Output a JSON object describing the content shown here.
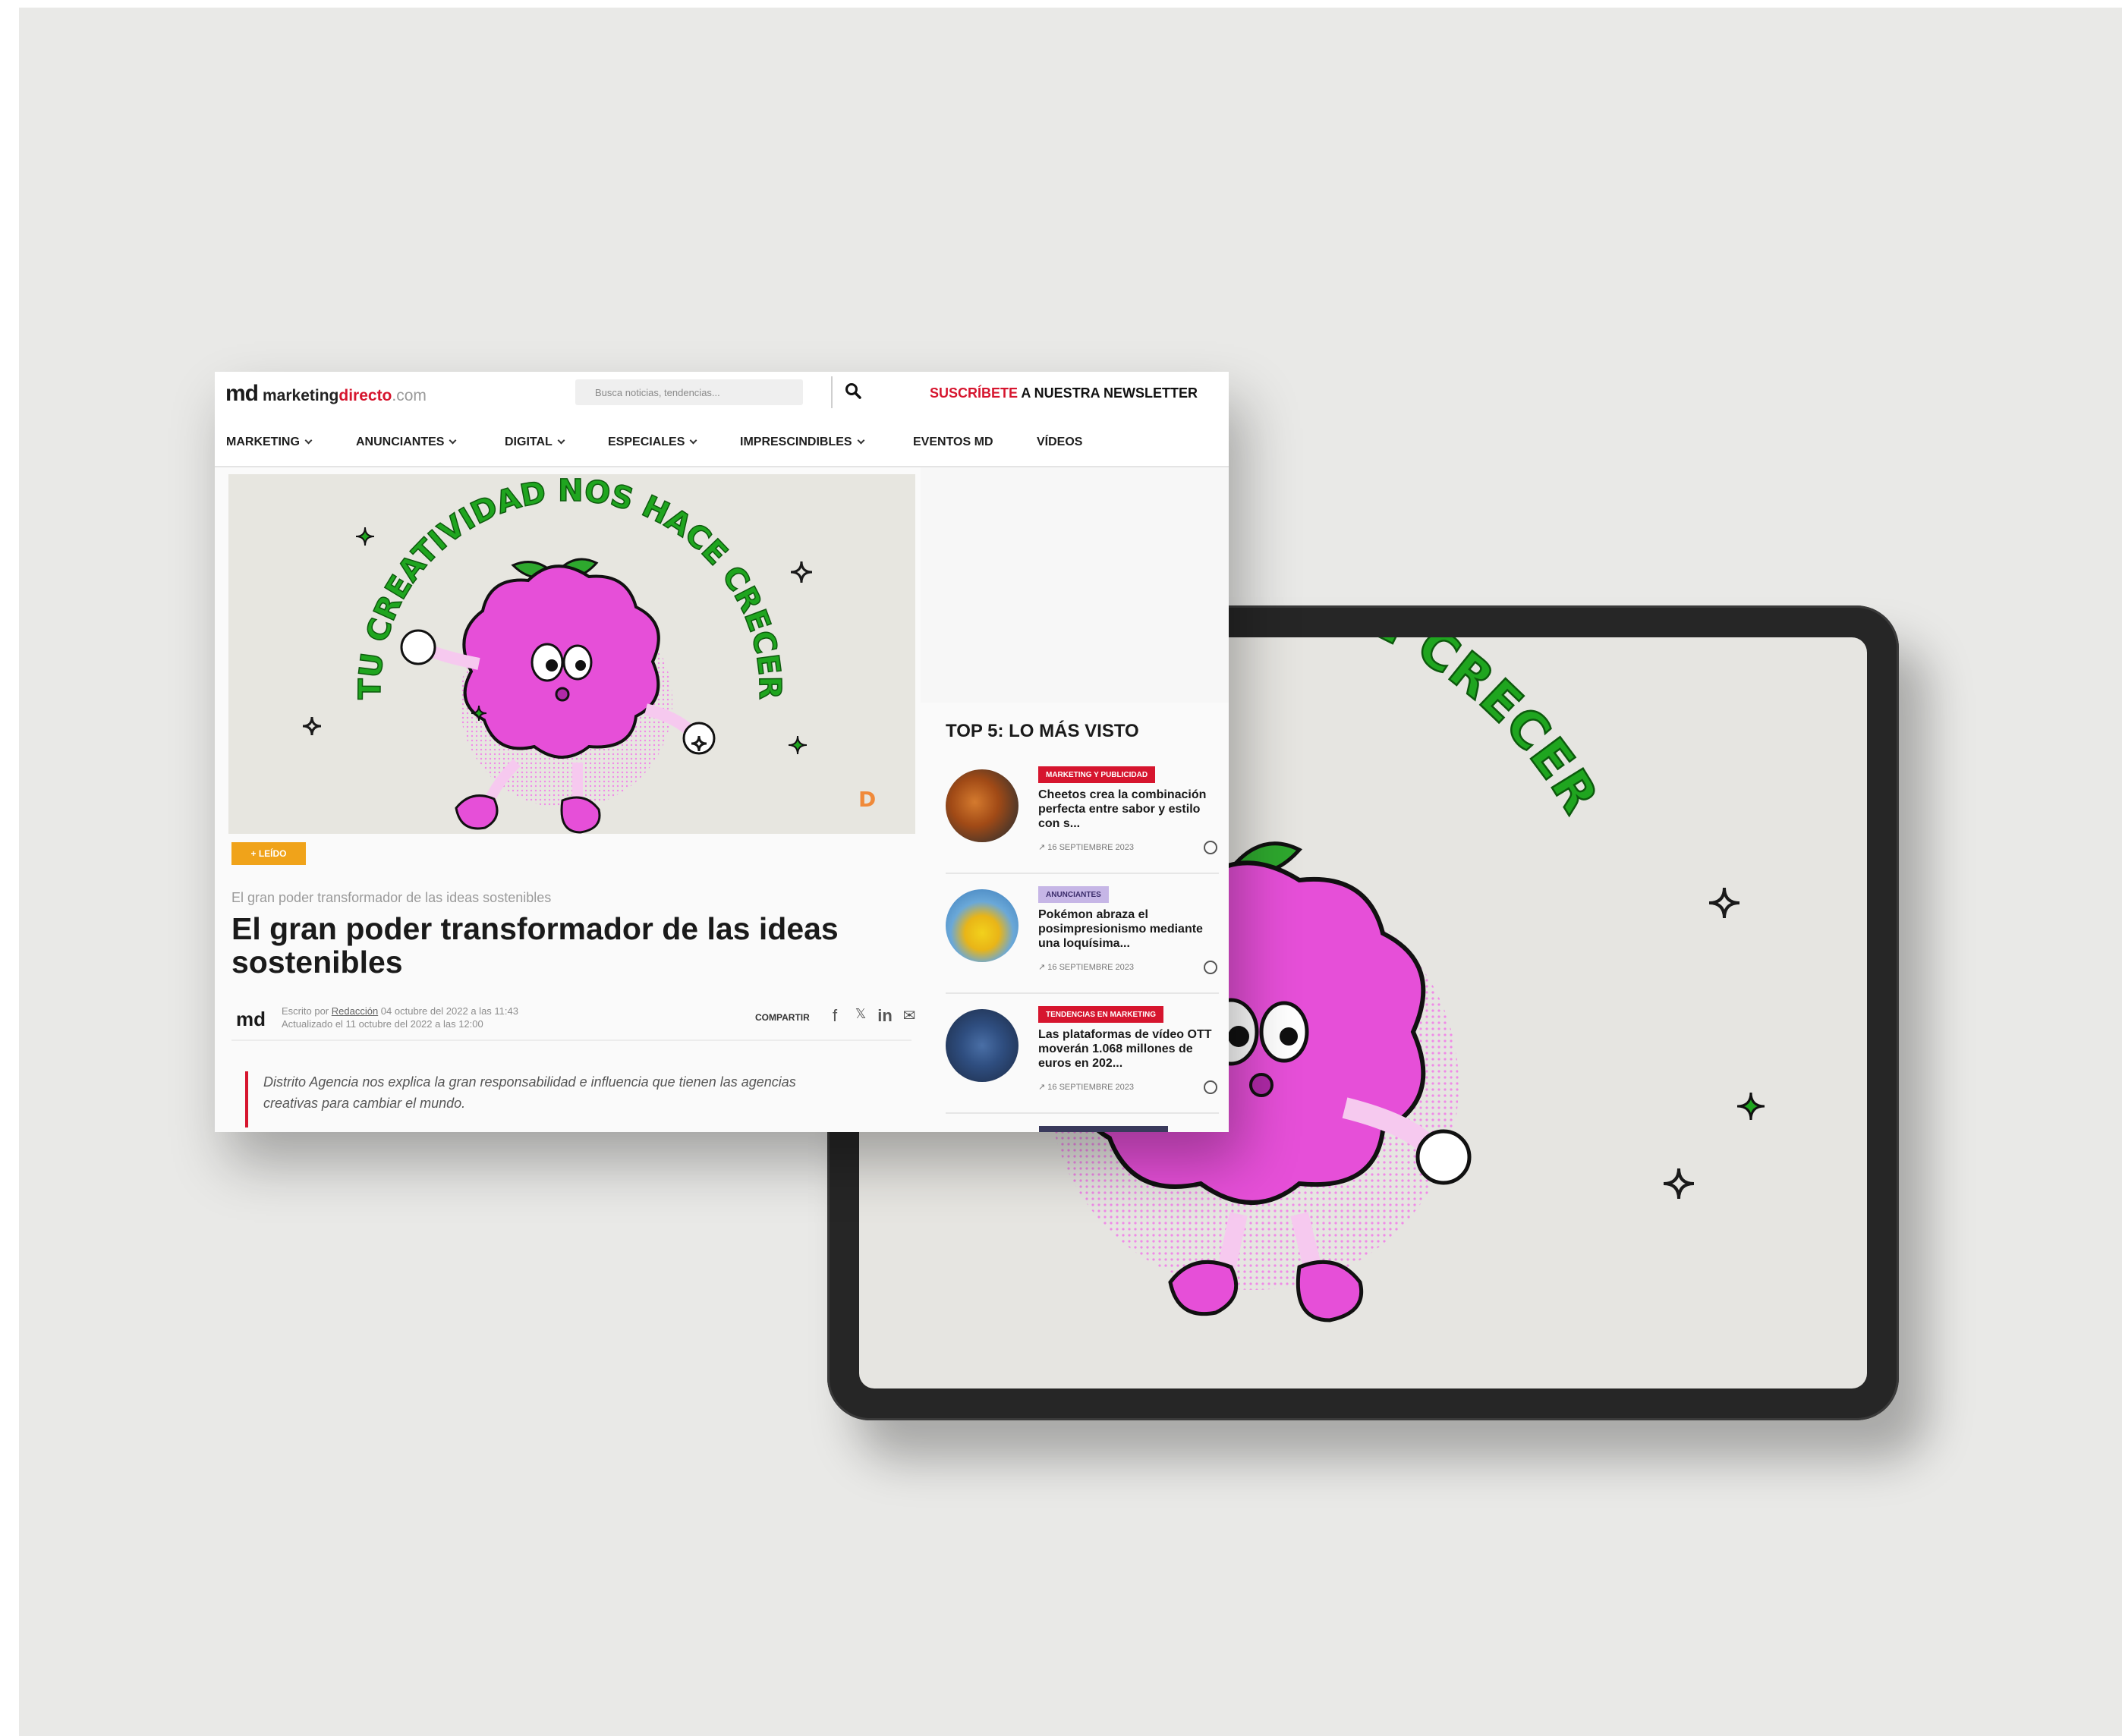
{
  "brand": {
    "logo_mark": "md",
    "logo_part1": "marketing",
    "logo_part2": "directo",
    "logo_part3": ".com"
  },
  "search": {
    "placeholder": "Busca noticias, tendencias..."
  },
  "newsletter": {
    "highlight": "SUSCRÍBETE",
    "rest": " A NUESTRA NEWSLETTER"
  },
  "nav": {
    "items": [
      {
        "label": "MARKETING",
        "dropdown": true
      },
      {
        "label": "ANUNCIANTES",
        "dropdown": true
      },
      {
        "label": "DIGITAL",
        "dropdown": true
      },
      {
        "label": "ESPECIALES",
        "dropdown": true
      },
      {
        "label": "IMPRESCINDIBLES",
        "dropdown": true
      },
      {
        "label": "EVENTOS MD",
        "dropdown": false
      },
      {
        "label": "VÍDEOS",
        "dropdown": false
      }
    ]
  },
  "hero": {
    "arc_text": "TU CREATIVIDAD NOS HACE CRECER",
    "tablet_arc_text": "IDAD NOS HACE CRECER",
    "signature": "D"
  },
  "article": {
    "tag": "+ LEÍDO",
    "kicker": "El gran poder transformador de las ideas sostenibles",
    "title": "El gran poder transformador de las ideas sostenibles",
    "byline_line1_prefix": "Escrito por ",
    "byline_author": "Redacción",
    "byline_line1_suffix": " 04 octubre del 2022 a las 11:43",
    "byline_line2": "Actualizado el 11 octubre del 2022 a las 12:00",
    "share_label": "COMPARTIR",
    "quote": "Distrito Agencia nos explica la gran responsabilidad e influencia que tienen las agencias creativas para cambiar el mundo."
  },
  "sidebar": {
    "heading": "TOP 5: LO MÁS VISTO",
    "items": [
      {
        "category": "MARKETING Y PUBLICIDAD",
        "headline": "Cheetos crea la combinación perfecta entre sabor y estilo con s...",
        "date": "16 SEPTIEMBRE 2023"
      },
      {
        "category": "ANUNCIANTES",
        "headline": "Pokémon abraza el posimpresionismo mediante una loquísima...",
        "date": "16 SEPTIEMBRE 2023"
      },
      {
        "category": "TENDENCIAS EN MARKETING",
        "headline": "Las plataformas de vídeo OTT moverán 1.068 millones de euros en 202...",
        "date": "16 SEPTIEMBRE 2023"
      }
    ]
  },
  "colors": {
    "brand_red": "#d6152e",
    "tag_orange": "#f0a31a",
    "brain_pink": "#e64fd8",
    "text_green": "#1fa51f",
    "background": "#e9e9e7"
  }
}
